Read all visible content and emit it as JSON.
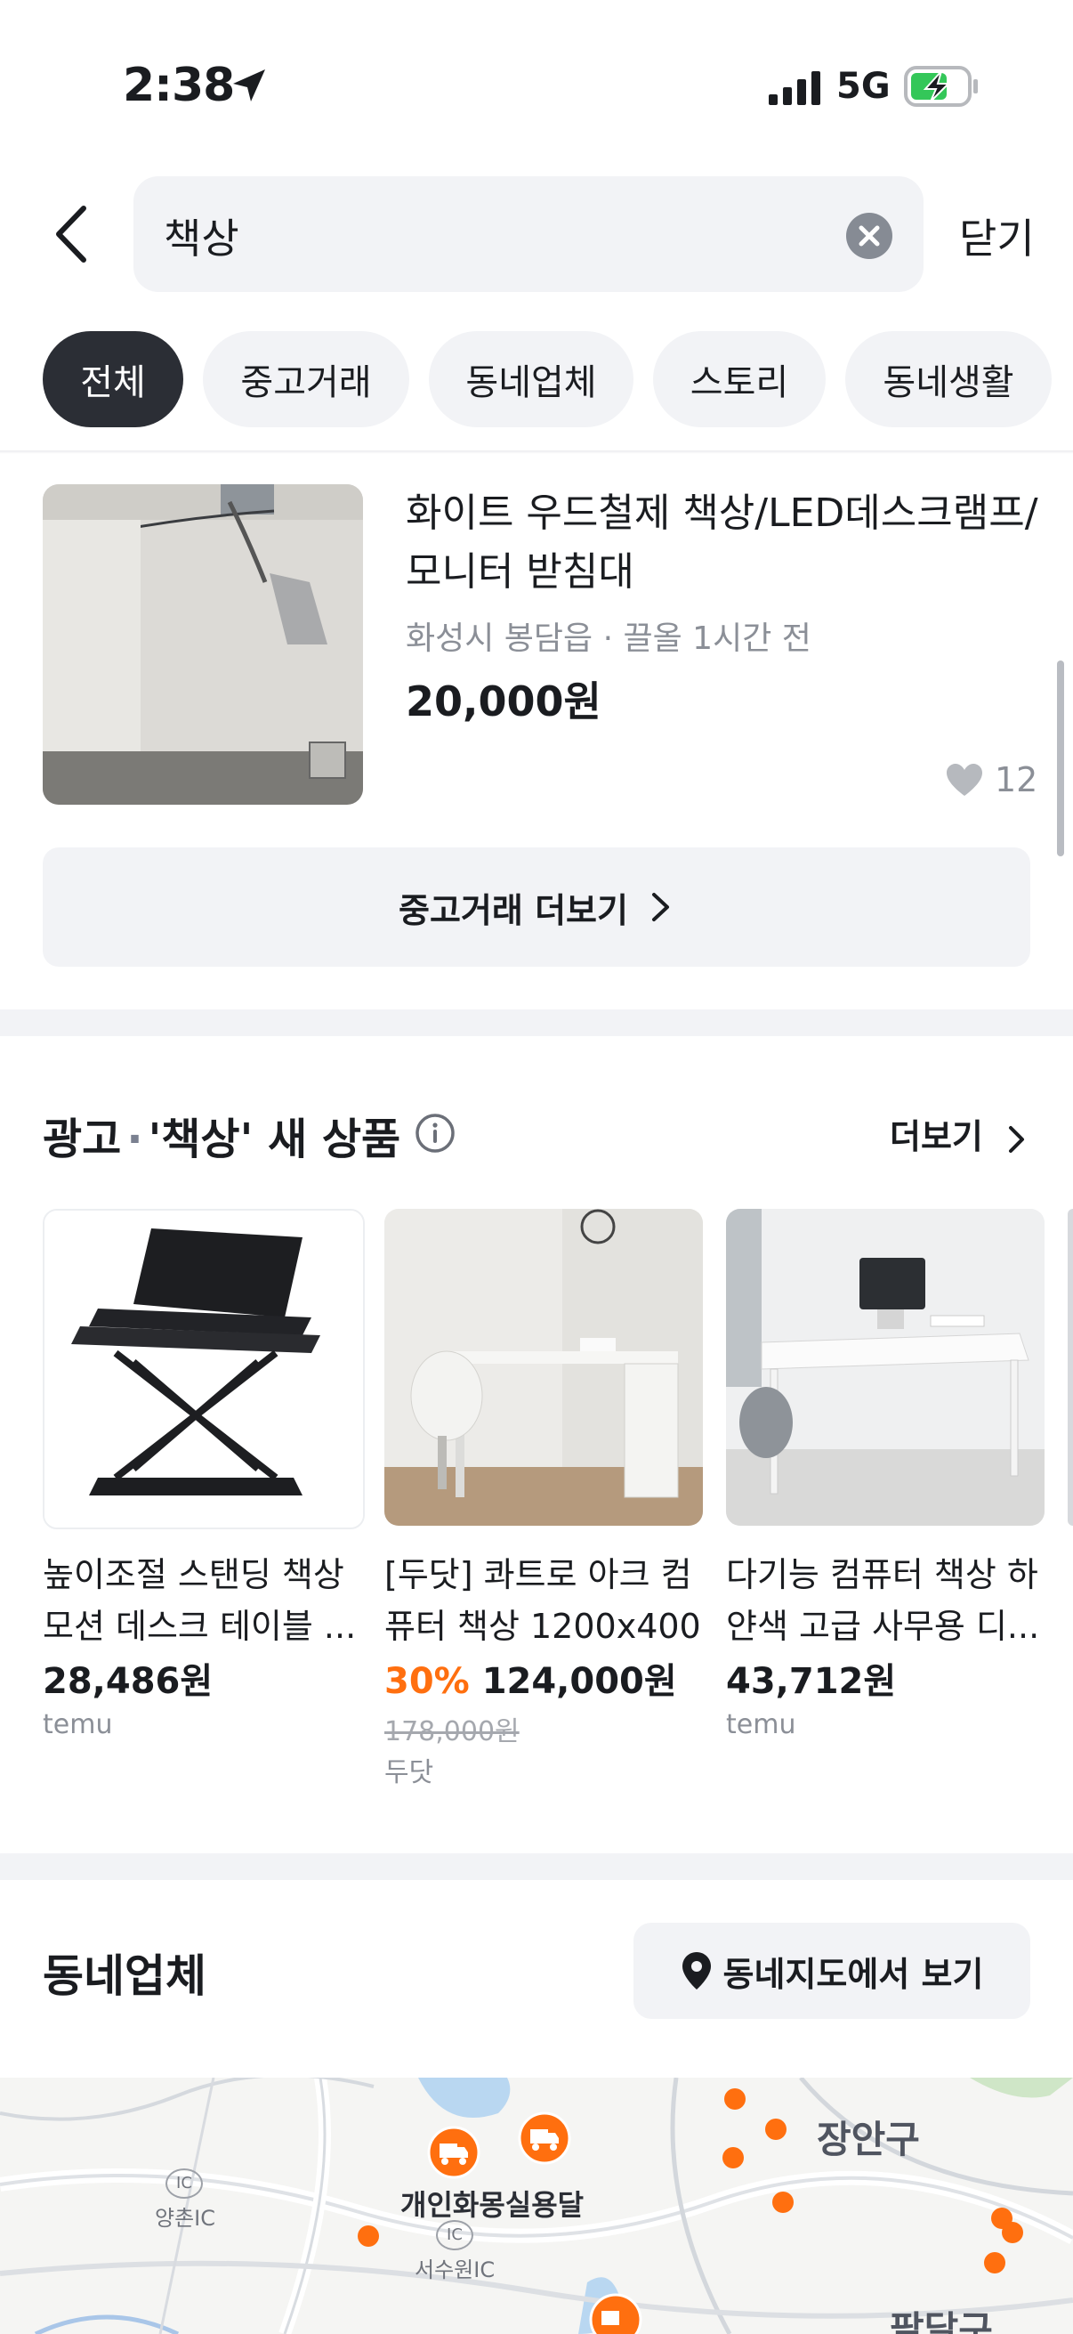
{
  "status_bar": {
    "time": "2:38",
    "network": "5G"
  },
  "search": {
    "query": "책상",
    "close_label": "닫기"
  },
  "chips": [
    "전체",
    "중고거래",
    "동네업체",
    "스토리",
    "동네생활"
  ],
  "listing": {
    "title": "화이트 우드철제 책상/LED데스크램프/모니터 받침대",
    "meta": "화성시 봉담읍 · 끌올 1시간 전",
    "price": "20,000원",
    "likes": "12"
  },
  "more_button": {
    "label": "중고거래 더보기"
  },
  "ad_section": {
    "title_prefix": "광고",
    "title_sep": "·",
    "title_main": "'책상' 새 상품",
    "more_label": "더보기",
    "products": [
      {
        "title": "높이조절 스탠딩 책상 모션 데스크 테이블 ...",
        "price": "28,486원",
        "seller": "temu"
      },
      {
        "title": "[두닷] 콰트로 아크 컴퓨터 책상 1200x400",
        "discount": "30%",
        "price": "124,000원",
        "original_price": "178,000원",
        "seller": "두닷"
      },
      {
        "title": "다기능 컴퓨터 책상 하얀색 고급 사무용 디...",
        "price": "43,712원",
        "seller": "temu"
      }
    ]
  },
  "business_section": {
    "title": "동네업체",
    "map_button_label": "동네지도에서 보기",
    "map_labels": {
      "district_1": "장안구",
      "district_2": "팔달구",
      "place": "개인화몽실용달",
      "ic_1": "IC",
      "ic_1_name": "양촌IC",
      "ic_2": "IC",
      "ic_2_name": "서수원IC"
    }
  },
  "colors": {
    "accent": "#ff6f0f",
    "chip_active": "#2b2e35",
    "muted": "#8b8f97",
    "surface": "#f2f3f6"
  },
  "icons": [
    "location-arrow-icon",
    "signal-icon",
    "battery-charging-icon",
    "back-chevron-icon",
    "clear-icon",
    "heart-icon",
    "chevron-right-icon",
    "info-icon",
    "location-pin-icon",
    "truck-marker-icon"
  ]
}
